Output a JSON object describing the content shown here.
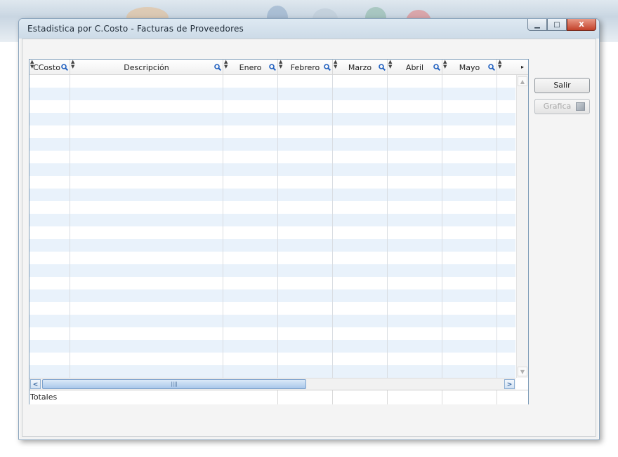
{
  "window": {
    "title": "Estadistica por C.Costo - Facturas de Proveedores",
    "controls": {
      "minimize": "▁",
      "maximize": "□",
      "close": "X"
    }
  },
  "grid": {
    "columns": [
      {
        "key": "ccosto",
        "label": "CCosto"
      },
      {
        "key": "descripcion",
        "label": "Descripción"
      },
      {
        "key": "enero",
        "label": "Enero"
      },
      {
        "key": "febrero",
        "label": "Febrero"
      },
      {
        "key": "marzo",
        "label": "Marzo"
      },
      {
        "key": "abril",
        "label": "Abril"
      },
      {
        "key": "mayo",
        "label": "Mayo"
      }
    ],
    "rows": [],
    "totals_label": "Totales"
  },
  "buttons": {
    "salir": "Salir",
    "grafica": "Grafica"
  },
  "colors": {
    "row_alt": "#e9f2fb",
    "grid_border": "#7f9db9",
    "search_icon": "#1f5fbf"
  },
  "icons": {
    "column_search": "magnifier-icon",
    "column_sort": "sort-arrows-icon",
    "grafica": "chart-image-icon"
  }
}
